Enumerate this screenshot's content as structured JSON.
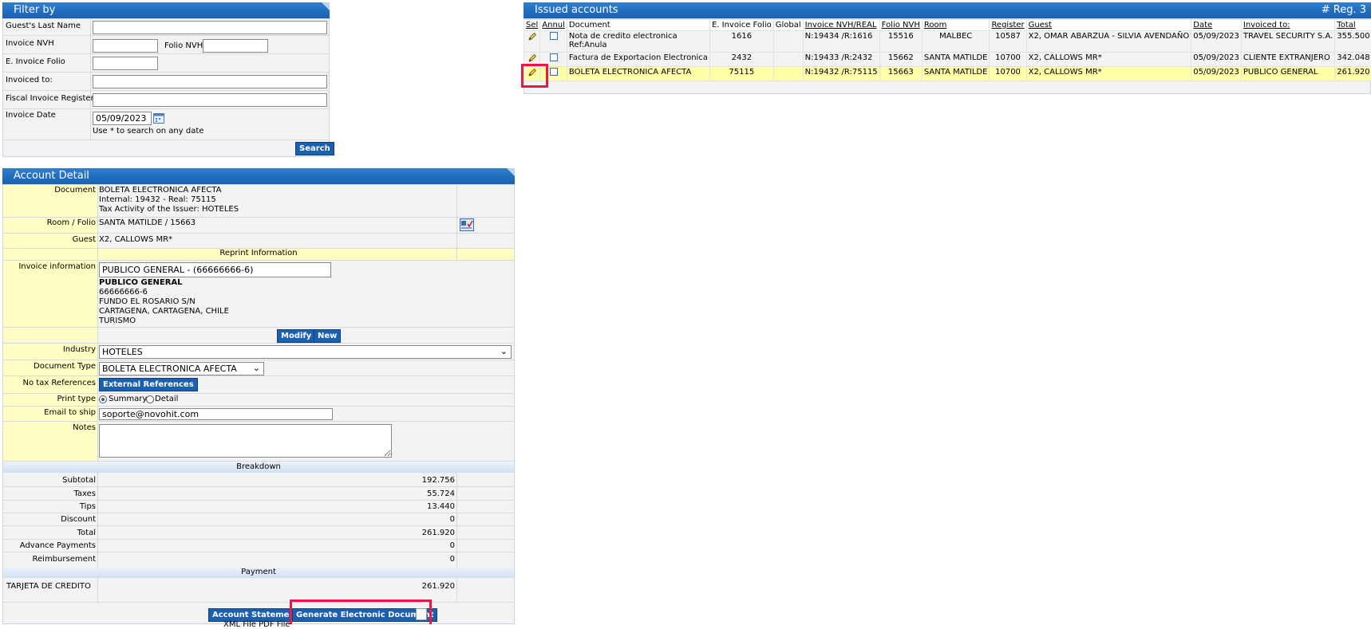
{
  "filter": {
    "header": "Filter by",
    "guest_last_name_label": "Guest's Last Name",
    "invoice_nvh_label": "Invoice NVH",
    "folio_nvh_label": "Folio NVH",
    "e_invoice_folio_label": "E. Invoice Folio",
    "invoiced_to_label": "Invoiced to:",
    "fiscal_register_label": "Fiscal Invoice Register",
    "invoice_date_label": "Invoice Date",
    "invoice_date_value": "05/09/2023",
    "date_hint": "Use * to search on any date",
    "search_button": "Search"
  },
  "issued": {
    "header": "Issued accounts",
    "reg_count": "# Reg. 3",
    "columns": [
      "Sel",
      "Annul",
      "Document",
      "E. Invoice Folio",
      "Global",
      "Invoice NVH/REAL",
      "Folio NVH",
      "Room",
      "Register",
      "Guest",
      "Date",
      "Invoiced to:",
      "Total"
    ],
    "rows": [
      {
        "document": "Nota de credito electronica",
        "document2": "Ref:Anula",
        "folio": "1616",
        "global": "",
        "invoice": "N:19434 /R:1616",
        "folio_nvh": "15516",
        "room": "MALBEC",
        "register": "10587",
        "guest": "X2, OMAR ABARZUA - SILVIA AVENDAÑO",
        "date": "05/09/2023",
        "invoiced_to": "TRAVEL SECURITY S.A.",
        "total": "355.500"
      },
      {
        "document": "Factura de Exportacion Electronica",
        "document2": "",
        "folio": "2432",
        "global": "",
        "invoice": "N:19433 /R:2432",
        "folio_nvh": "15662",
        "room": "SANTA MATILDE",
        "register": "10700",
        "guest": "X2, CALLOWS MR*",
        "date": "05/09/2023",
        "invoiced_to": "CLIENTE EXTRANJERO",
        "total": "342.048"
      },
      {
        "document": "BOLETA ELECTRONICA AFECTA",
        "document2": "",
        "folio": "75115",
        "global": "",
        "invoice": "N:19432 /R:75115",
        "folio_nvh": "15663",
        "room": "SANTA MATILDE",
        "register": "10700",
        "guest": "X2, CALLOWS MR*",
        "date": "05/09/2023",
        "invoiced_to": "PUBLICO GENERAL",
        "total": "261.920"
      }
    ]
  },
  "detail": {
    "header": "Account Detail",
    "document_label": "Document",
    "document_line1": "BOLETA ELECTRONICA AFECTA",
    "document_line2": "Internal: 19432 - Real: 75115",
    "document_line3": "Tax Activity of the Issuer: HOTELES",
    "room_folio_label": "Room / Folio",
    "room_folio_value": "SANTA MATILDE / 15663",
    "guest_label": "Guest",
    "guest_value": "X2, CALLOWS MR*",
    "reprint_header": "Reprint Information",
    "invoice_info_label": "Invoice information",
    "invoice_select_value": "PUBLICO GENERAL - (66666666-6)",
    "inv_name": "PUBLICO GENERAL",
    "inv_rut": "66666666-6",
    "inv_addr": "FUNDO EL ROSARIO S/N",
    "inv_city": "CARTAGENA, CARTAGENA, CHILE",
    "inv_activity": "TURISMO",
    "modify_button": "Modify",
    "new_button": "New",
    "industry_label": "Industry",
    "industry_value": "HOTELES",
    "doc_type_label": "Document Type",
    "doc_type_value": "BOLETA ELECTRONICA AFECTA",
    "no_tax_label": "No tax References",
    "external_refs_button": "External References",
    "print_type_label": "Print type",
    "print_summary": "Summary",
    "print_detail": "Detail",
    "email_label": "Email to ship",
    "email_value": "soporte@novohit.com",
    "notes_label": "Notes",
    "breakdown_header": "Breakdown",
    "subtotal_label": "Subtotal",
    "subtotal": "192.756",
    "taxes_label": "Taxes",
    "taxes": "55.724",
    "tips_label": "Tips",
    "tips": "13.440",
    "discount_label": "Discount",
    "discount": "0",
    "total_label": "Total",
    "total": "261.920",
    "advance_label": "Advance Payments",
    "advance": "0",
    "reimb_label": "Reimbursement",
    "reimb": "0",
    "payment_header": "Payment",
    "payment_method": "TARJETA DE CREDITO",
    "payment_amount": "261.920",
    "account_statement_button": "Account Statement",
    "generate_button": "Generate Electronic Document",
    "files_text": "XML File   PDF File"
  },
  "colors": {
    "highlight": "#e6194b",
    "accent": "#1b5fb0",
    "label_bg": "#ffffc4"
  }
}
